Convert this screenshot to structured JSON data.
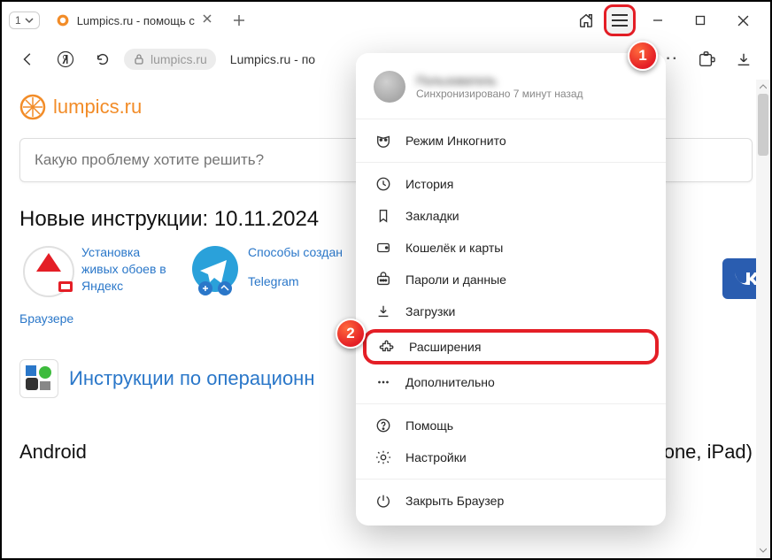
{
  "tabs": {
    "count": "1",
    "active_title": "Lumpics.ru - помощь с"
  },
  "address": {
    "host": "lumpics.ru",
    "title_fragment": "Lumpics.ru - по"
  },
  "page": {
    "logo_text": "lumpics.ru",
    "search_placeholder": "Какую проблему хотите решить?",
    "section_title": "Новые инструкции: 10.11.2024",
    "card1": "Установка живых обоев в Яндекс",
    "card1_extra": "Браузере",
    "card2": "Способы создан",
    "card2_extra": "Telegram",
    "os_link": "Инструкции по операционн",
    "bottom_left": "Android",
    "bottom_right": "iOS (iPhone, iPad)"
  },
  "menu": {
    "profile_name": "Пользователь",
    "sync_status": "Синхронизировано 7 минут назад",
    "items": [
      {
        "label": "Режим Инкогнито"
      },
      {
        "label": "История"
      },
      {
        "label": "Закладки"
      },
      {
        "label": "Кошелёк и карты"
      },
      {
        "label": "Пароли и данные"
      },
      {
        "label": "Загрузки"
      },
      {
        "label": "Расширения"
      },
      {
        "label": "Дополнительно"
      },
      {
        "label": "Помощь"
      },
      {
        "label": "Настройки"
      },
      {
        "label": "Закрыть Браузер"
      }
    ]
  },
  "callouts": {
    "one": "1",
    "two": "2"
  }
}
